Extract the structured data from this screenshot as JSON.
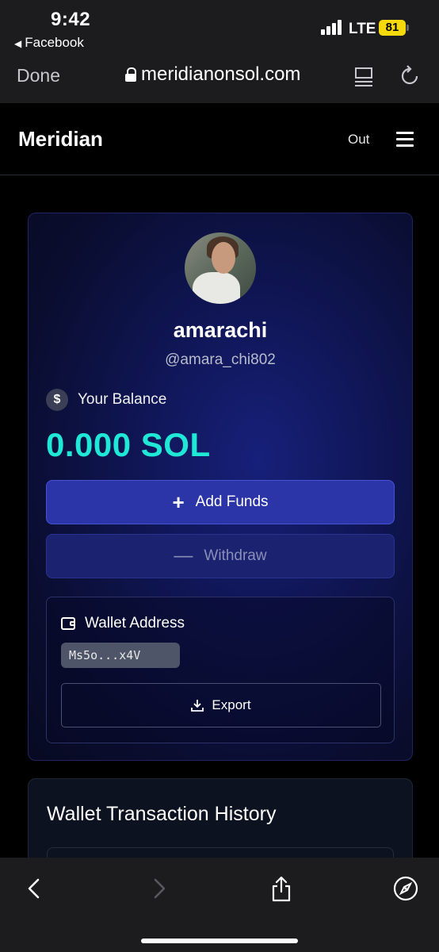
{
  "status_bar": {
    "time": "9:42",
    "back_app": "Facebook",
    "network": "LTE",
    "battery": "81"
  },
  "browser": {
    "done_label": "Done",
    "url": "meridianonsol.com",
    "reader_icon": "reader-mode-icon",
    "reload_icon": "reload-icon"
  },
  "site": {
    "brand": "Meridian",
    "out_label": "Out",
    "menu_icon": "hamburger-menu-icon"
  },
  "profile": {
    "username": "amarachi",
    "handle": "@amara_chi802",
    "balance_label": "Your Balance",
    "balance_icon": "$",
    "balance_value": "0.000 SOL",
    "balance_color": "#20e8d6",
    "add_funds_label": "Add Funds",
    "withdraw_label": "Withdraw",
    "wallet_title": "Wallet Address",
    "wallet_address": "Ms5o...x4V",
    "export_label": "Export"
  },
  "history": {
    "title": "Wallet Transaction History"
  },
  "colors": {
    "accent": "#2b35a8",
    "card_bg": "#0f1552",
    "battery": "#f5d90a"
  }
}
